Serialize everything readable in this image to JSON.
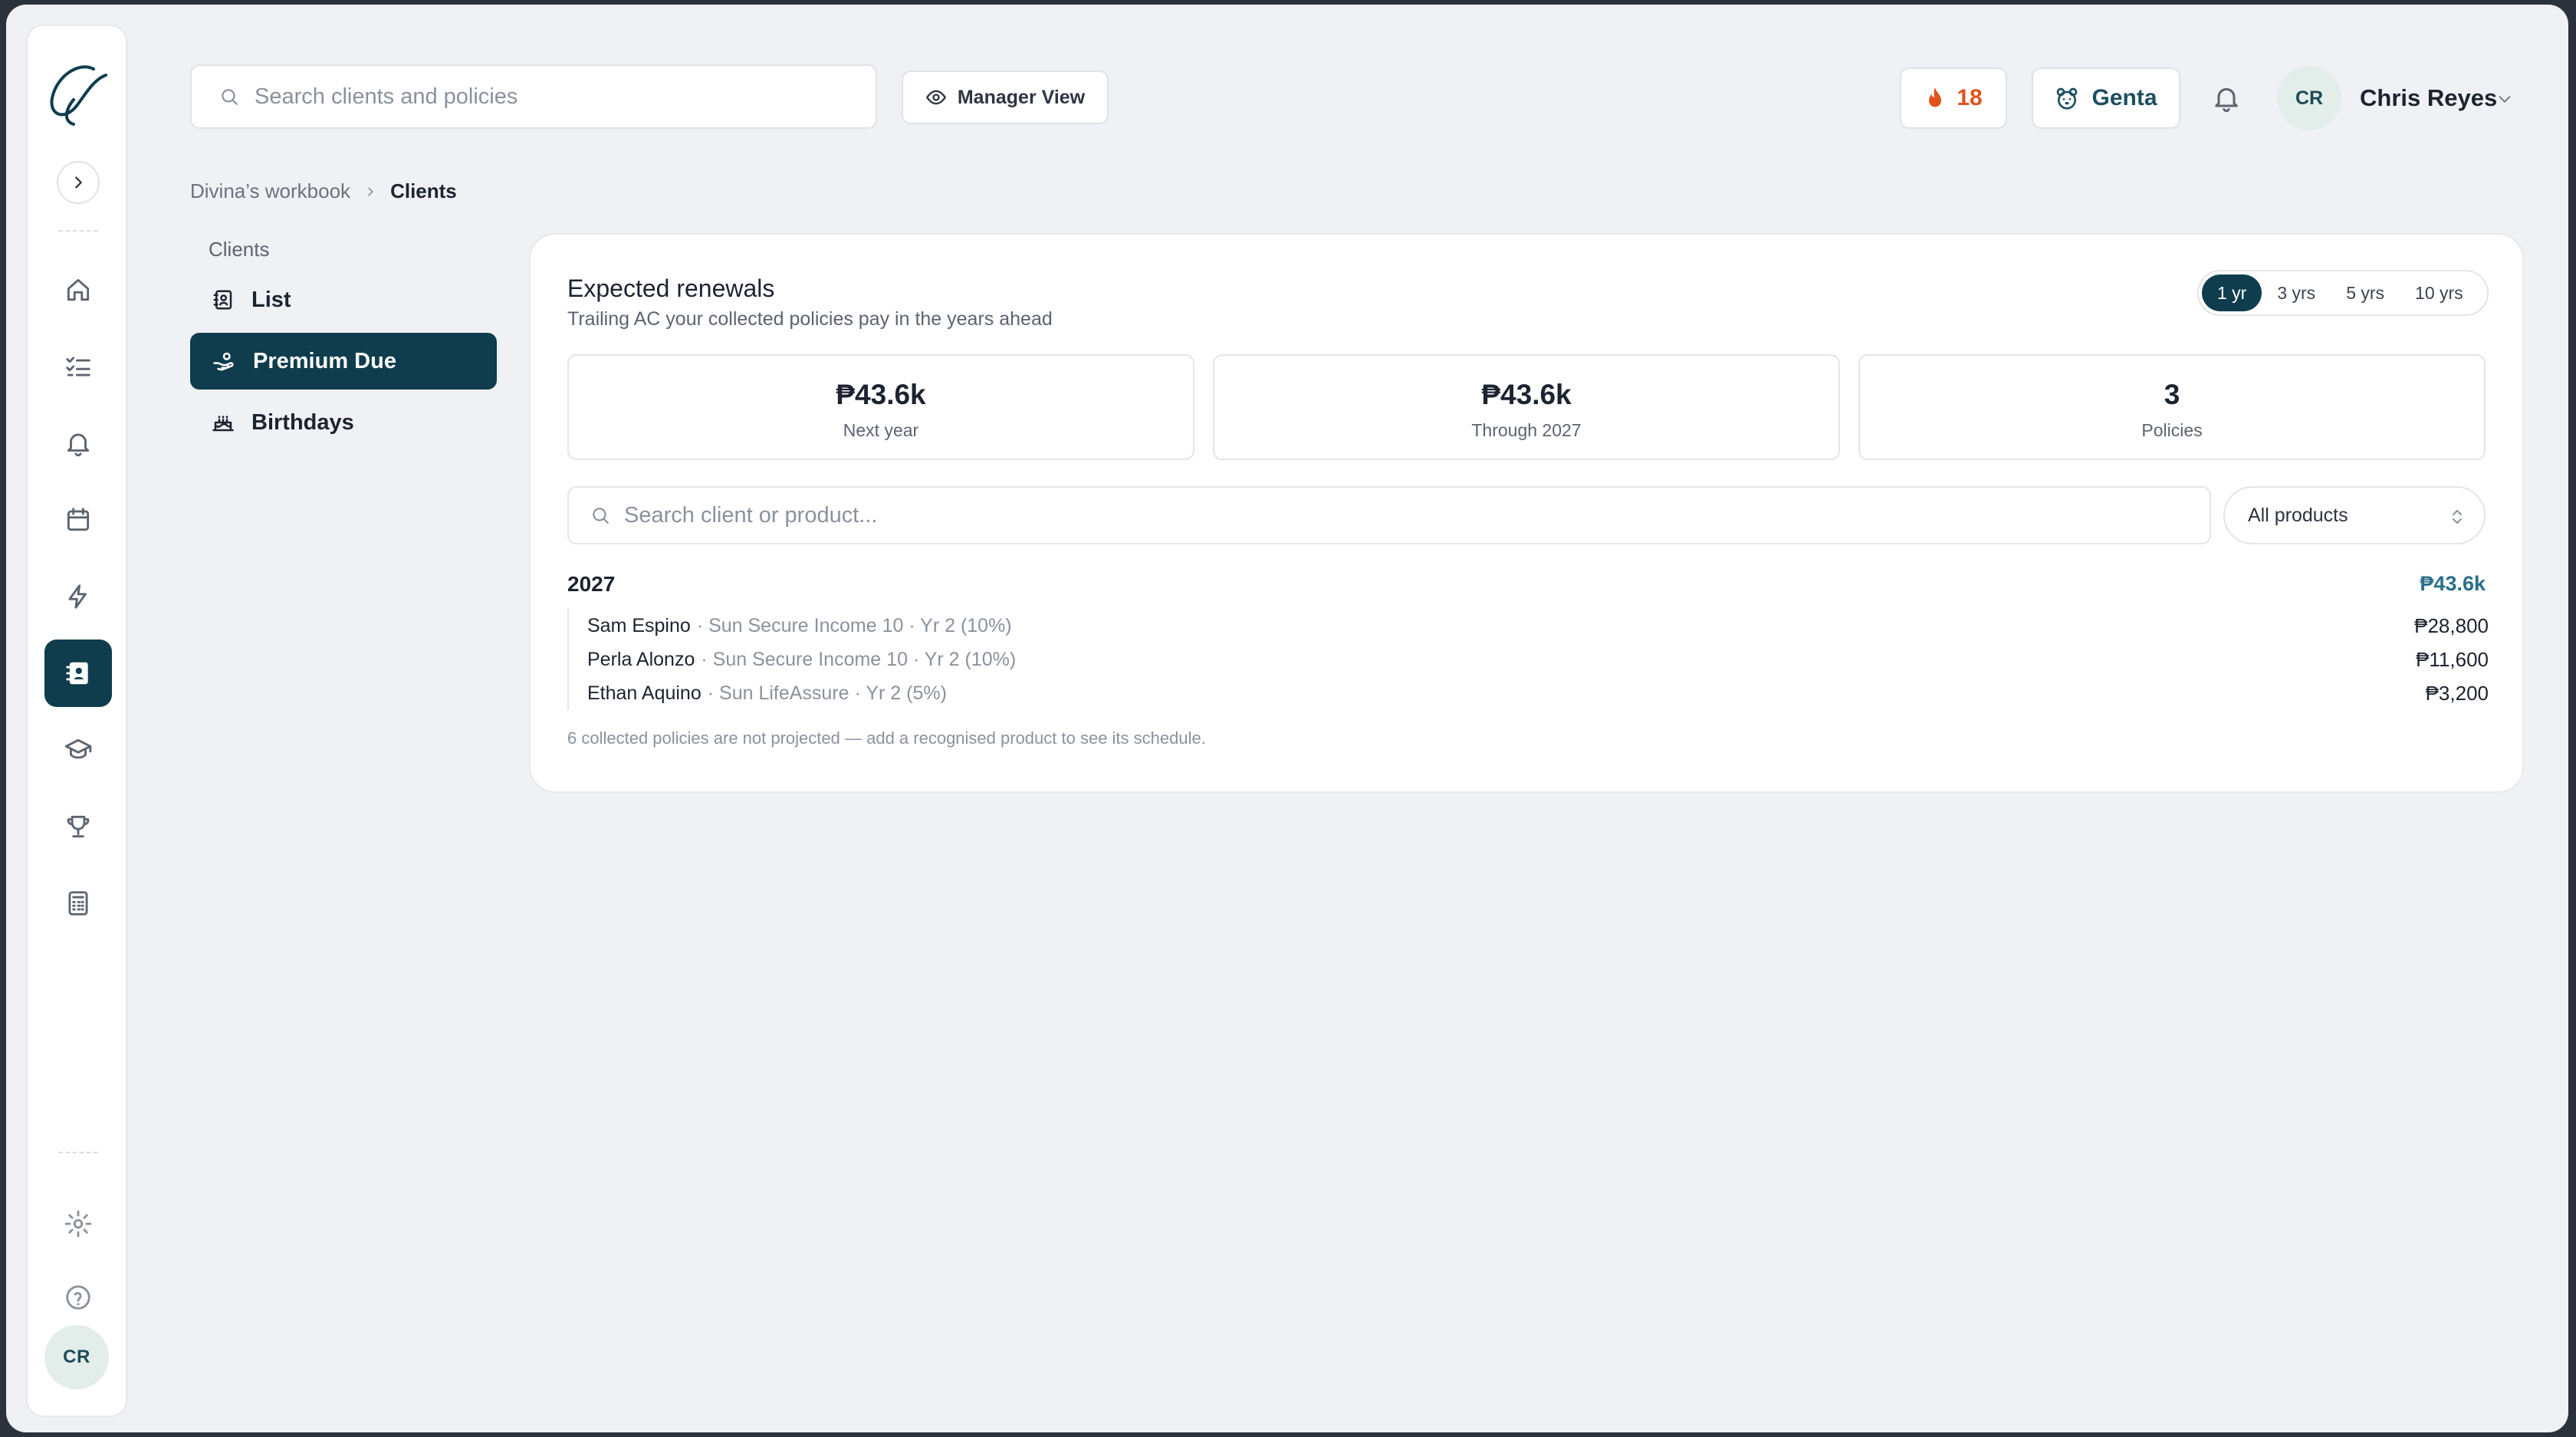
{
  "user": {
    "initials": "CR",
    "name": "Chris Reyes"
  },
  "topbar": {
    "search_placeholder": "Search clients and policies",
    "manager_view_label": "Manager View",
    "streak_count": "18",
    "assistant_label": "Genta"
  },
  "breadcrumb": {
    "parent": "Divina’s workbook",
    "current": "Clients"
  },
  "subnav": {
    "title": "Clients",
    "items": [
      {
        "label": "List",
        "icon": "contact-book-icon"
      },
      {
        "label": "Premium Due",
        "icon": "hand-coins-icon",
        "active": true
      },
      {
        "label": "Birthdays",
        "icon": "cake-icon"
      }
    ]
  },
  "rail": {
    "items": [
      "home-icon",
      "tasks-icon",
      "bell-icon",
      "calendar-icon",
      "lightning-icon",
      "contacts-icon",
      "graduation-cap-icon",
      "trophy-icon",
      "calculator-icon",
      "gear-icon",
      "help-icon"
    ],
    "active": "contacts-icon"
  },
  "card": {
    "title": "Expected renewals",
    "subtitle": "Trailing AC your collected policies pay in the years ahead",
    "ranges": [
      "1 yr",
      "3 yrs",
      "5 yrs",
      "10 yrs"
    ],
    "active_range": "1 yr",
    "stats": [
      {
        "value": "₱43.6k",
        "label": "Next year"
      },
      {
        "value": "₱43.6k",
        "label": "Through 2027"
      },
      {
        "value": "3",
        "label": "Policies"
      }
    ],
    "search_placeholder": "Search client or product...",
    "product_filter": "All products",
    "groups": [
      {
        "year": "2027",
        "total": "₱43.6k",
        "rows": [
          {
            "name": "Sam Espino",
            "detail": "· Sun Secure Income 10 · Yr 2 (10%)",
            "amount": "₱28,800"
          },
          {
            "name": "Perla Alonzo",
            "detail": "· Sun Secure Income 10 · Yr 2 (10%)",
            "amount": "₱11,600"
          },
          {
            "name": "Ethan Aquino",
            "detail": "· Sun LifeAssure · Yr 2 (5%)",
            "amount": "₱3,200"
          }
        ]
      }
    ],
    "footnote": "6 collected policies are not projected — add a recognised product to see its schedule."
  },
  "colors": {
    "accent": "#0f3d4e",
    "total": "#2a6f8a",
    "streak": "#e0531e",
    "background": "#f0f1f4"
  }
}
